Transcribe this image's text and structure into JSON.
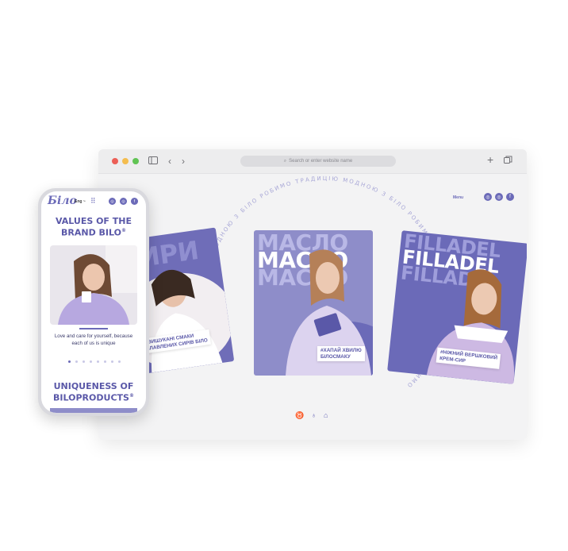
{
  "browser": {
    "address_placeholder": "Search or enter website name",
    "nav": {
      "back_icon": "chevron-left-icon",
      "forward_icon": "chevron-right-icon",
      "sidebar_icon": "sidebar-icon",
      "new_tab_icon": "plus-icon",
      "tabs_icon": "tabs-icon"
    },
    "window_controls": [
      "#ec5f57",
      "#f4bd4f",
      "#61c454"
    ]
  },
  "site": {
    "ring_text": "ТРАДИЦІЮ МОДНОЮ З БІЛО РОБИМО",
    "menu_label": "Menu",
    "social": [
      "instagram",
      "instagram",
      "facebook"
    ],
    "cards": {
      "left": {
        "big_word": "СИРИ",
        "tag_line1": "#ВИШУКАНІ СМАКИ",
        "tag_line2": "ПЛАВЛЕНИХ СИРІВ БІЛО"
      },
      "center": {
        "big_word": "МАСЛО",
        "tag_line1": "#ХАПАЙ ХВИЛЮ",
        "tag_line2": "БІЛОСМАКУ"
      },
      "right": {
        "big_word": "FILLADEL",
        "tag_line1": "#НІЖНИЙ ВЕРШКОВИЙ",
        "tag_line2": "КРЕМ-СИР"
      }
    },
    "bottom_icons": [
      "cow-icon",
      "milk-icon",
      "factory-icon"
    ]
  },
  "phone": {
    "logo": "Біло",
    "lang": "Eng ~",
    "section1_title_line1": "VALUES OF THE",
    "section1_title_line2": "BRAND BILO",
    "caption_line1": "Love and care for yourself, because",
    "caption_line2": "each of us is unique",
    "section2_title_line1": "UNIQUENESS OF",
    "section2_title_line2": "BILOPRODUCTS",
    "registered": "®",
    "slide_count": 8,
    "active_slide": 1
  },
  "colors": {
    "brand": "#6b6ab8",
    "brand_light": "#8e8dc9",
    "lavender": "#d8d3ec"
  }
}
